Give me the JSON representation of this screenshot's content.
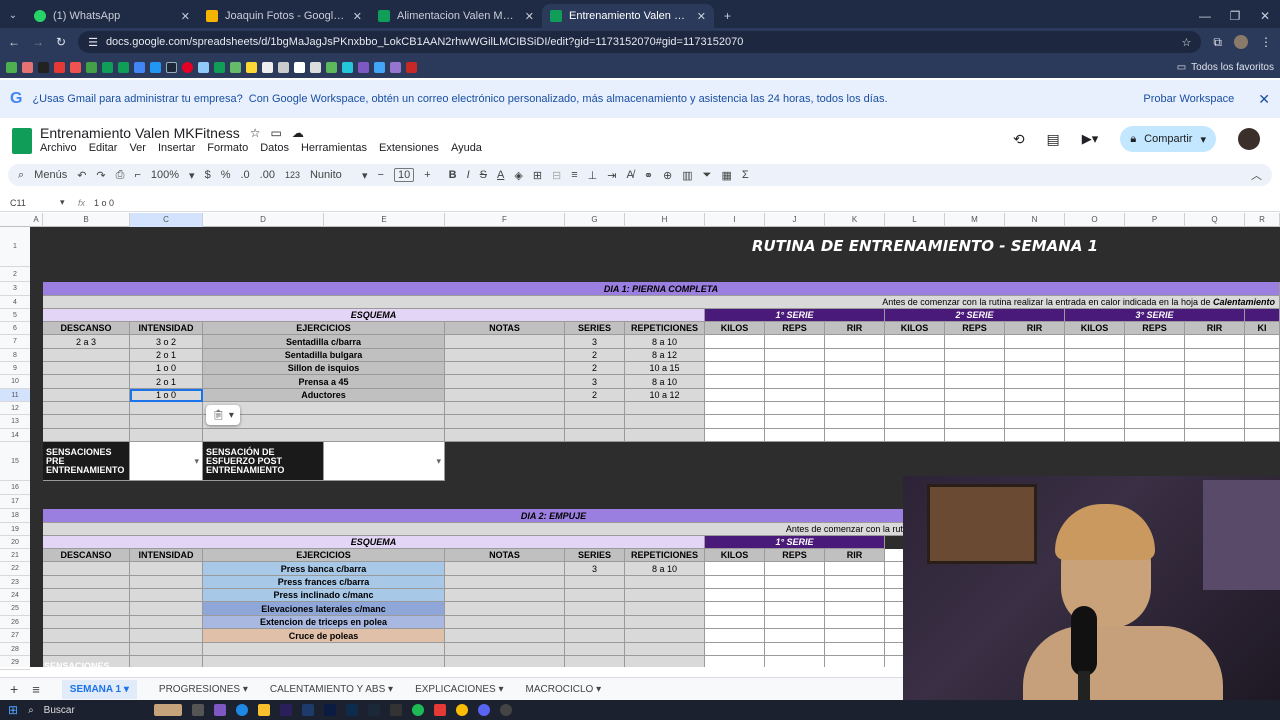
{
  "browser": {
    "tabs": [
      {
        "title": "(1) WhatsApp",
        "color": "#25d366"
      },
      {
        "title": "Joaquin Fotos - Google Drive",
        "color": "#f4b400"
      },
      {
        "title": "Alimentacion Valen MKFitness",
        "color": "#0f9d58"
      },
      {
        "title": "Entrenamiento Valen MKFitness",
        "color": "#0f9d58"
      }
    ],
    "url": "docs.google.com/spreadsheets/d/1bgMaJagJsPKnxbbo_LokCB1AAN2rhwWGilLMCIBSiDI/edit?gid=1173152070#gid=1173152070",
    "all_bookmarks": "Todos los favoritos"
  },
  "promo": {
    "question": "¿Usas Gmail para administrar tu empresa?",
    "text": "Con Google Workspace, obtén un correo electrónico personalizado, más almacenamiento y asistencia las 24 horas, todos los días.",
    "cta": "Probar Workspace"
  },
  "doc": {
    "title": "Entrenamiento Valen MKFitness",
    "menus": [
      "Archivo",
      "Editar",
      "Ver",
      "Insertar",
      "Formato",
      "Datos",
      "Herramientas",
      "Extensiones",
      "Ayuda"
    ],
    "share": "Compartir"
  },
  "toolbar": {
    "menus": "Menús",
    "zoom": "100%",
    "currency": "$",
    "percent": "%",
    "dec_less": ".0",
    "dec_more": ".00",
    "num_format": "123",
    "font": "Nunito",
    "size": "10"
  },
  "formula": {
    "ref": "C11",
    "fx": "fx",
    "value": "1 o 0"
  },
  "columns": [
    "A",
    "B",
    "C",
    "D",
    "E",
    "F",
    "G",
    "H",
    "I",
    "J",
    "K",
    "L",
    "M",
    "N",
    "O",
    "P",
    "Q",
    "R"
  ],
  "rows": [
    "1",
    "2",
    "3",
    "4",
    "5",
    "6",
    "7",
    "8",
    "9",
    "10",
    "11",
    "12",
    "13",
    "14",
    "15",
    "16",
    "17",
    "18",
    "19",
    "20",
    "21",
    "22",
    "23",
    "24",
    "25",
    "26",
    "27",
    "28",
    "29"
  ],
  "sheet": {
    "title": "RUTINA DE ENTRENAMIENTO - SEMANA 1",
    "day1": "DIA 1: PIERNA COMPLETA",
    "day2": "DIA 2: EMPUJE",
    "note_prefix": "Antes de comenzar con la rutina realizar la entrada en calor indicada en la hoja de",
    "note_bold": "Calentamiento",
    "note_truncated": "Antes de comenzar con la rutina realizar la entrada en calor indicada",
    "esquema": "ESQUEMA",
    "serie1": "1° SERIE",
    "serie2": "2° SERIE",
    "serie3": "3° SERIE",
    "headers": [
      "DESCANSO",
      "INTENSIDAD",
      "EJERCICIOS",
      "NOTAS",
      "SERIES",
      "REPETICIONES"
    ],
    "sub_headers": [
      "KILOS",
      "REPS",
      "RIR",
      "KILOS",
      "REPS",
      "RIR",
      "KILOS",
      "REPS",
      "RIR",
      "KI"
    ],
    "day1_rows": [
      {
        "descanso": "2 a 3",
        "intensidad": "3 o 2",
        "ejercicio": "Sentadilla c/barra",
        "series": "3",
        "reps": "8 a 10"
      },
      {
        "descanso": "",
        "intensidad": "2 o 1",
        "ejercicio": "Sentadilla bulgara",
        "series": "2",
        "reps": "8 a 12"
      },
      {
        "descanso": "",
        "intensidad": "1 o 0",
        "ejercicio": "Sillon de isquios",
        "series": "2",
        "reps": "10 a 15"
      },
      {
        "descanso": "",
        "intensidad": "2 o 1",
        "ejercicio": "Prensa a 45",
        "series": "3",
        "reps": "8 a 10"
      },
      {
        "descanso": "",
        "intensidad": "1 o 0",
        "ejercicio": "Aductores",
        "series": "2",
        "reps": "10 a 12"
      }
    ],
    "sensaciones_pre": "SENSACIONES PRE ENTRENAMIENTO",
    "sensacion_post": "SENSACIÓN DE ESFUERZO POST ENTRENAMIENTO",
    "sensaciones_cut": "SENSACIONES",
    "day2_rows": [
      {
        "ejercicio": "Press banca c/barra",
        "series": "3",
        "reps": "8 a 10"
      },
      {
        "ejercicio": "Press frances c/barra",
        "series": "",
        "reps": ""
      },
      {
        "ejercicio": "Press inclinado c/manc",
        "series": "",
        "reps": ""
      },
      {
        "ejercicio": "Elevaciones laterales c/manc",
        "series": "",
        "reps": ""
      },
      {
        "ejercicio": "Extencion de triceps en polea",
        "series": "",
        "reps": ""
      },
      {
        "ejercicio": "Cruce de poleas",
        "series": "",
        "reps": ""
      }
    ]
  },
  "sheet_tabs": [
    "SEMANA 1",
    "PROGRESIONES",
    "CALENTAMIENTO Y ABS",
    "EXPLICACIONES",
    "MACROCICLO"
  ],
  "taskbar": {
    "search": "Buscar"
  },
  "colors": {
    "purple": "#9b7fe0",
    "dark_purple": "#4a1a7a",
    "lavender": "#e3d5f5"
  }
}
